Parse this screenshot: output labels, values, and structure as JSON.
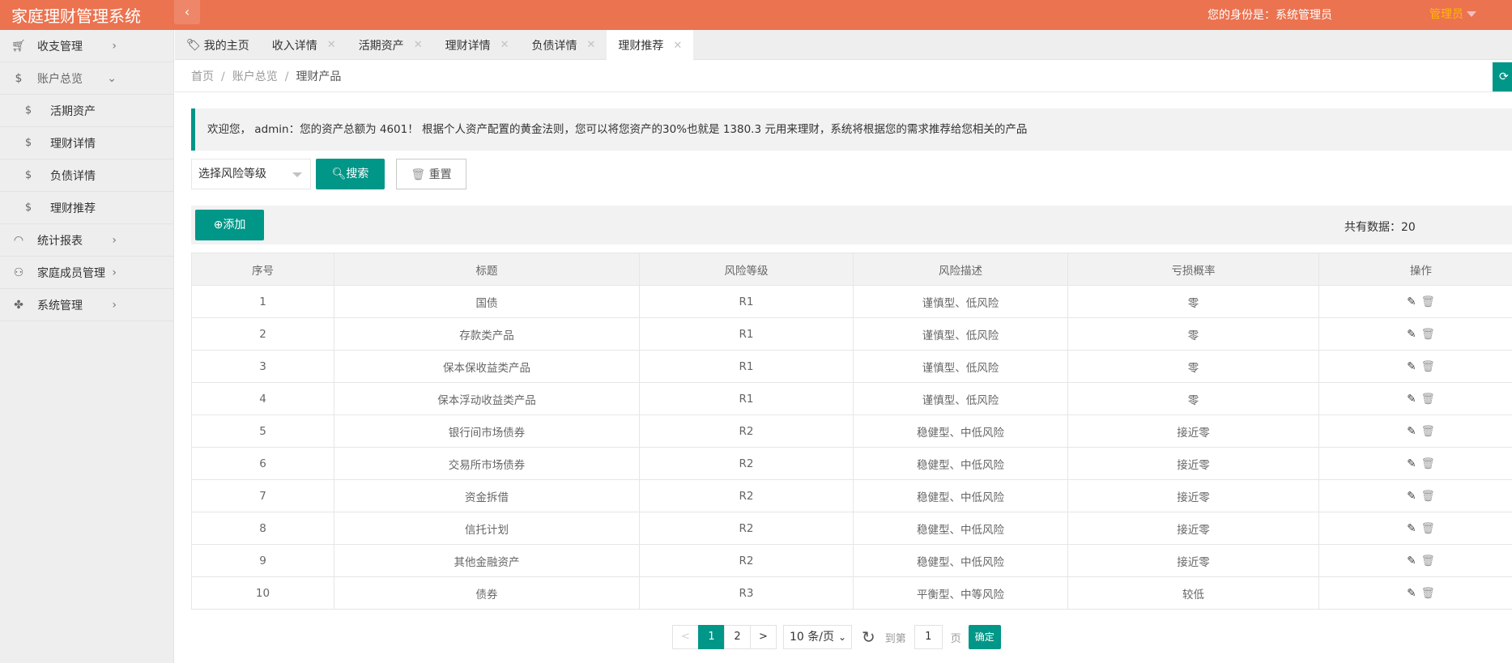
{
  "header": {
    "title": "家庭理财管理系统",
    "identity": "您的身份是：系统管理员",
    "user": "管理员"
  },
  "sidebar": {
    "items": [
      {
        "label": "收支管理",
        "icon": "cart-icon"
      },
      {
        "label": "账户总览",
        "icon": "dollar-icon"
      },
      {
        "label": "活期资产",
        "icon": "dollar-icon"
      },
      {
        "label": "理财详情",
        "icon": "dollar-icon"
      },
      {
        "label": "负债详情",
        "icon": "dollar-icon"
      },
      {
        "label": "理财推荐",
        "icon": "dollar-icon"
      },
      {
        "label": "统计报表",
        "icon": "chart-icon"
      },
      {
        "label": "家庭成员管理",
        "icon": "user-icon"
      },
      {
        "label": "系统管理",
        "icon": "settings-icon"
      }
    ]
  },
  "tabs": [
    {
      "label": "我的主页"
    },
    {
      "label": "收入详情"
    },
    {
      "label": "活期资产"
    },
    {
      "label": "理财详情"
    },
    {
      "label": "负债详情"
    },
    {
      "label": "理财推荐"
    }
  ],
  "breadcrumb": [
    "首页",
    "账户总览",
    "理财产品"
  ],
  "alert": "欢迎您， admin：您的资产总额为 4601！ 根据个人资产配置的黄金法则，您可以将您资产的30%也就是 1380.3 元用来理财，系统将根据您的需求推荐给您相关的产品",
  "filter": {
    "select_placeholder": "选择风险等级",
    "search": "搜索",
    "reset": "重置"
  },
  "toolbar": {
    "add": "添加",
    "total": "共有数据：20"
  },
  "table": {
    "headers": [
      "序号",
      "标题",
      "风险等级",
      "风险描述",
      "亏损概率",
      "操作"
    ],
    "rows": [
      [
        "1",
        "国债",
        "R1",
        "谨慎型、低风险",
        "零"
      ],
      [
        "2",
        "存款类产品",
        "R1",
        "谨慎型、低风险",
        "零"
      ],
      [
        "3",
        "保本保收益类产品",
        "R1",
        "谨慎型、低风险",
        "零"
      ],
      [
        "4",
        "保本浮动收益类产品",
        "R1",
        "谨慎型、低风险",
        "零"
      ],
      [
        "5",
        "银行间市场债券",
        "R2",
        "稳健型、中低风险",
        "接近零"
      ],
      [
        "6",
        "交易所市场债券",
        "R2",
        "稳健型、中低风险",
        "接近零"
      ],
      [
        "7",
        "资金拆借",
        "R2",
        "稳健型、中低风险",
        "接近零"
      ],
      [
        "8",
        "信托计划",
        "R2",
        "稳健型、中低风险",
        "接近零"
      ],
      [
        "9",
        "其他金融资产",
        "R2",
        "稳健型、中低风险",
        "接近零"
      ],
      [
        "10",
        "债券",
        "R3",
        "平衡型、中等风险",
        "较低"
      ]
    ]
  },
  "pager": {
    "prev": "<",
    "pages": [
      "1",
      "2"
    ],
    "next": ">",
    "size": "10 条/页",
    "goto": "到第",
    "page_value": "1",
    "page_suffix": "页",
    "confirm": "确定"
  }
}
